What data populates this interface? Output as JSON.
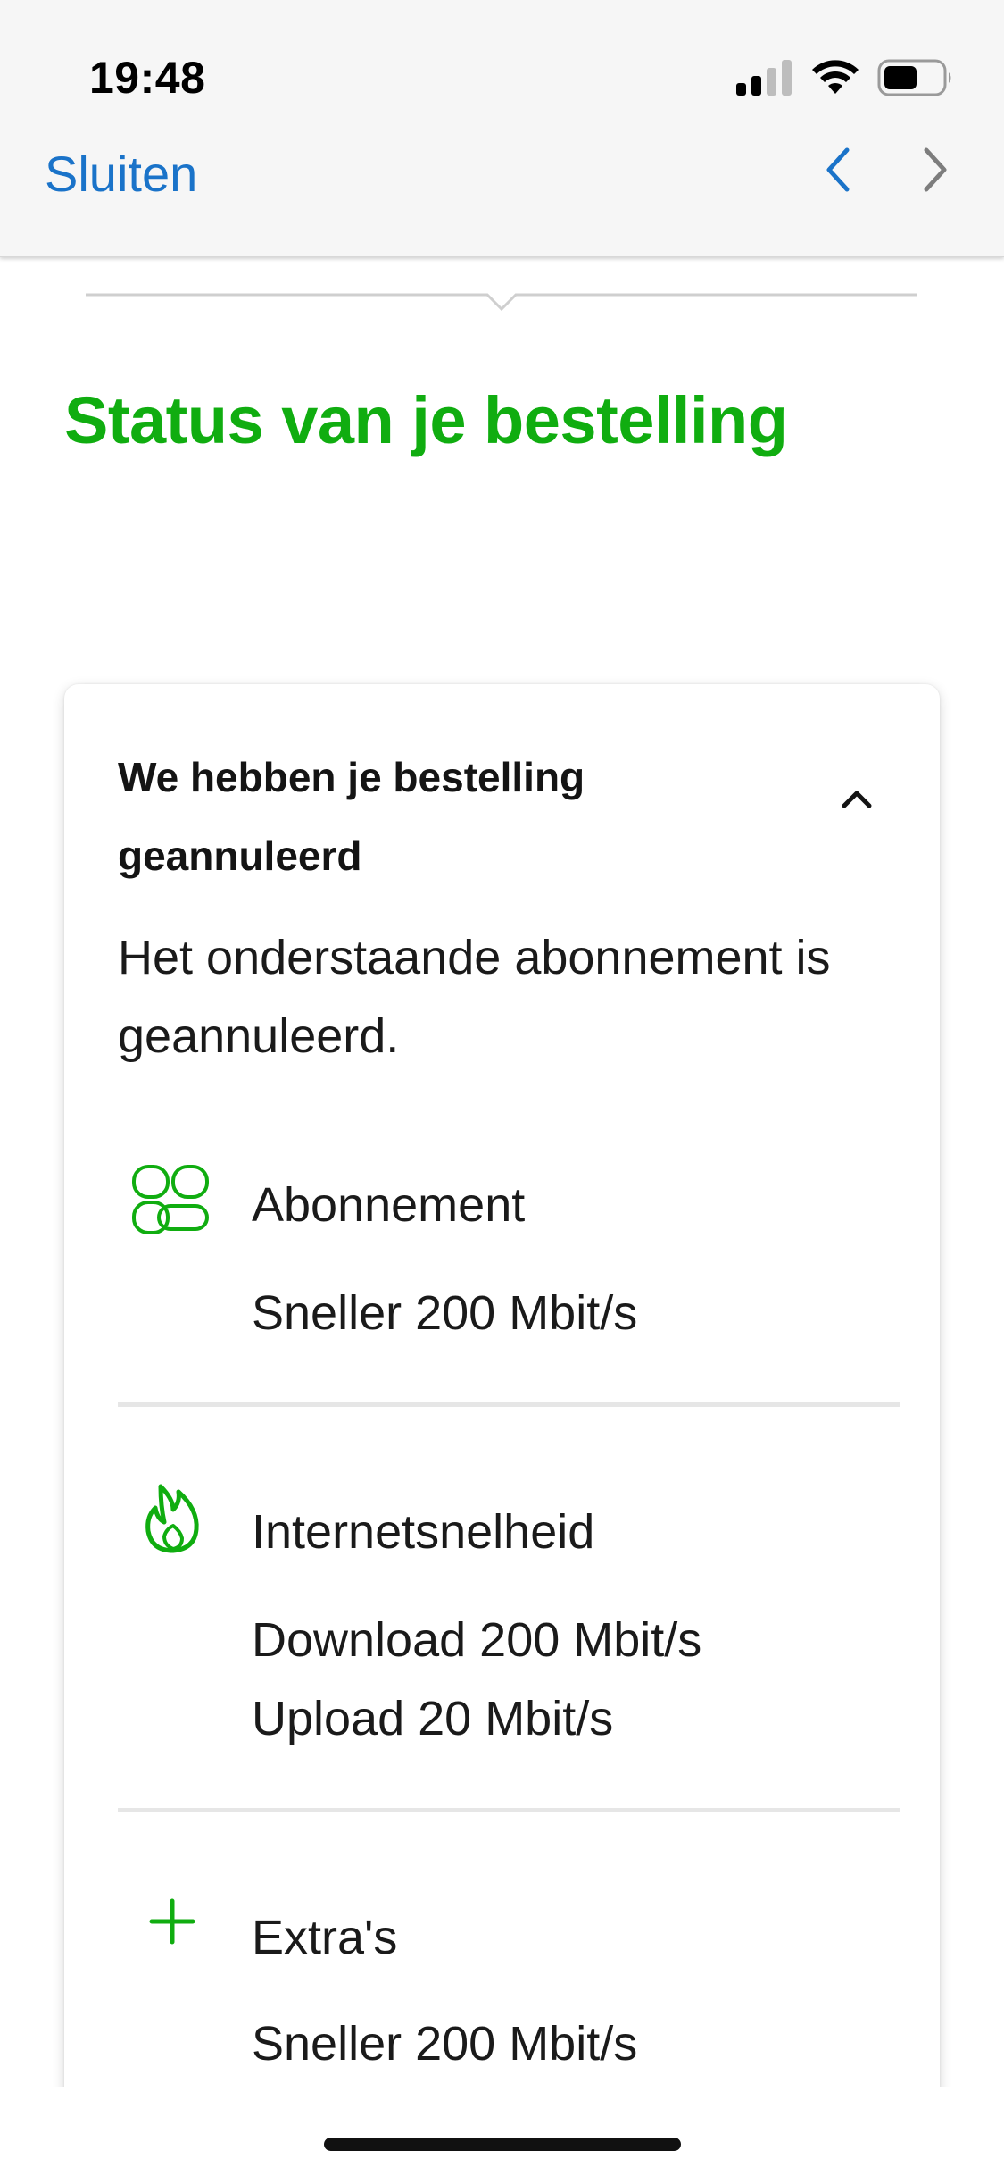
{
  "status_bar": {
    "time": "19:48"
  },
  "nav": {
    "close_label": "Sluiten"
  },
  "title": "Status van je bestelling",
  "card": {
    "heading_line1": "We hebben je bestelling",
    "heading_line2": "geannuleerd",
    "intro_line1": "Het onderstaande abonnement is",
    "intro_line2": "geannuleerd.",
    "rows": [
      {
        "icon": "subscription-icon",
        "label": "Abonnement",
        "values": [
          "Sneller 200 Mbit/s"
        ]
      },
      {
        "icon": "flame-icon",
        "label": "Internetsnelheid",
        "values": [
          "Download 200 Mbit/s",
          "Upload 20 Mbit/s"
        ]
      },
      {
        "icon": "plus-icon",
        "label": "Extra's",
        "values": [
          "Sneller 200 Mbit/s"
        ]
      }
    ]
  },
  "colors": {
    "brand_green": "#10ad10",
    "link_blue": "#1a73c9"
  }
}
